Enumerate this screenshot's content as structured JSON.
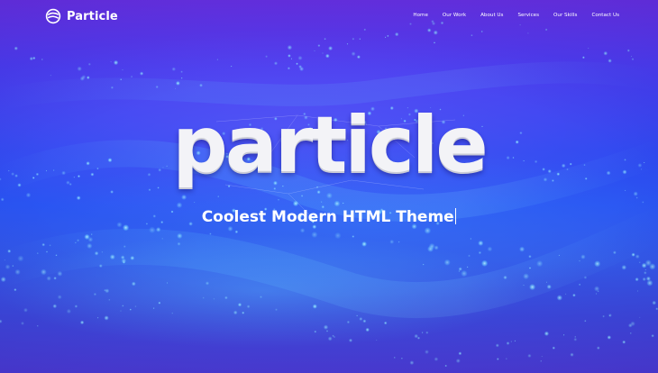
{
  "brand": {
    "name": "Particle"
  },
  "nav": {
    "items": [
      {
        "label": "Home"
      },
      {
        "label": "Our Work"
      },
      {
        "label": "About Us"
      },
      {
        "label": "Services"
      },
      {
        "label": "Our Skills"
      },
      {
        "label": "Contact Us"
      }
    ]
  },
  "hero": {
    "title": "particle",
    "subtitle": "Coolest Modern HTML Theme"
  },
  "colors": {
    "background_top": "#6a33e6",
    "background_mid": "#2a55f2",
    "particle": "#7fe0ff",
    "text": "#ffffff"
  }
}
